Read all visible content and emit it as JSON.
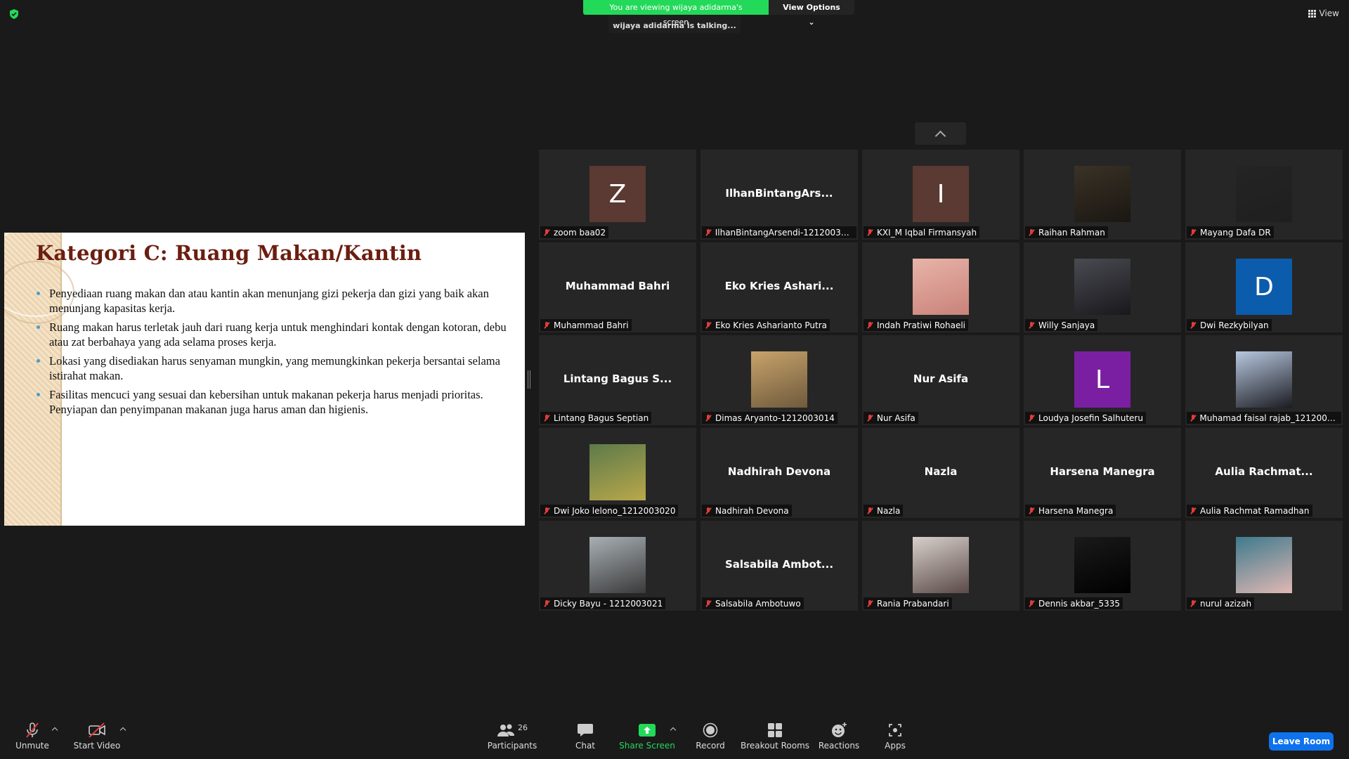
{
  "banner": {
    "viewing": "You are viewing wijaya adidarma's screen",
    "options": "View Options",
    "talking": "wijaya adidarma is talking..."
  },
  "view_label": "View",
  "slide": {
    "title": "Kategori C: Ruang Makan/Kantin",
    "bullets": [
      "Penyediaan ruang makan dan atau kantin akan menunjang gizi pekerja dan  gizi yang baik akan menunjang kapasitas kerja.",
      "Ruang makan harus terletak jauh dari ruang kerja untuk menghindari kontak dengan kotoran, debu atau zat berbahaya yang ada selama proses kerja.",
      "Lokasi yang disediakan harus senyaman mungkin, yang memungkinkan pekerja bersantai selama istirahat makan.",
      "Fasilitas mencuci yang sesuai dan kebersihan untuk makanan pekerja harus menjadi prioritas. Penyiapan dan penyimpanan makanan juga harus aman dan higienis."
    ]
  },
  "participants": [
    {
      "name": "zoom baa02",
      "kind": "letter",
      "letter": "Z",
      "color": "#5a3a32"
    },
    {
      "name": "IlhanBintangArsendi-1212003017",
      "kind": "text",
      "display": "IlhanBintangArs..."
    },
    {
      "name": "KXI_M Iqbal Firmansyah",
      "kind": "letter",
      "letter": "I",
      "color": "#5a3a32"
    },
    {
      "name": "Raihan Rahman",
      "kind": "photo",
      "colors": [
        "#3a3226",
        "#1a1612"
      ]
    },
    {
      "name": "Mayang Dafa DR",
      "kind": "photo",
      "colors": [
        "#242424",
        "#1f1f1f"
      ]
    },
    {
      "name": "Muhammad Bahri",
      "kind": "text",
      "display": "Muhammad Bahri"
    },
    {
      "name": "Eko Kries Asharianto Putra",
      "kind": "text",
      "display": "Eko Kries Ashari..."
    },
    {
      "name": "Indah Pratiwi Rohaeli",
      "kind": "photo",
      "colors": [
        "#e8b4a8",
        "#c9827a"
      ]
    },
    {
      "name": "Willy Sanjaya",
      "kind": "photo",
      "colors": [
        "#4a4a52",
        "#18181c"
      ]
    },
    {
      "name": "Dwi Rezkybilyan",
      "kind": "letter",
      "letter": "D",
      "color": "#0b5cad"
    },
    {
      "name": "Lintang Bagus Septian",
      "kind": "text",
      "display": "Lintang Bagus S..."
    },
    {
      "name": "Dimas Aryanto-1212003014",
      "kind": "photo",
      "colors": [
        "#c8a36b",
        "#6e5a3c"
      ]
    },
    {
      "name": "Nur Asifa",
      "kind": "text",
      "display": "Nur Asifa"
    },
    {
      "name": "Loudya Josefin Salhuteru",
      "kind": "letter",
      "letter": "L",
      "color": "#7b1fa2"
    },
    {
      "name": "Muhamad faisal rajab_12120030...",
      "kind": "photo",
      "colors": [
        "#b7c8e0",
        "#1c1c22"
      ]
    },
    {
      "name": "Dwi Joko lelono_1212003020",
      "kind": "photo",
      "colors": [
        "#5d7a4a",
        "#b9a84a"
      ]
    },
    {
      "name": "Nadhirah Devona",
      "kind": "text",
      "display": "Nadhirah Devona"
    },
    {
      "name": "Nazla",
      "kind": "text",
      "display": "Nazla"
    },
    {
      "name": "Harsena Manegra",
      "kind": "text",
      "display": "Harsena Manegra"
    },
    {
      "name": "Aulia Rachmat Ramadhan",
      "kind": "text",
      "display": "Aulia  Rachmat..."
    },
    {
      "name": "Dicky Bayu - 1212003021",
      "kind": "photo",
      "colors": [
        "#a8b0b4",
        "#3a3a3a"
      ]
    },
    {
      "name": "Salsabila Ambotuwo",
      "kind": "text",
      "display": "Salsabila  Ambot..."
    },
    {
      "name": "Rania Prabandari",
      "kind": "photo",
      "colors": [
        "#d8d0cc",
        "#5a4a48"
      ]
    },
    {
      "name": "Dennis akbar_5335",
      "kind": "photo",
      "colors": [
        "#1a1a1a",
        "#000000"
      ]
    },
    {
      "name": "nurul azizah",
      "kind": "photo",
      "colors": [
        "#3e7a8c",
        "#e0b8b4"
      ]
    }
  ],
  "toolbar": {
    "unmute": "Unmute",
    "start_video": "Start Video",
    "participants": "Participants",
    "participants_count": "26",
    "chat": "Chat",
    "share_screen": "Share Screen",
    "record": "Record",
    "breakout": "Breakout Rooms",
    "reactions": "Reactions",
    "apps": "Apps",
    "leave": "Leave Room"
  },
  "colors": {
    "accent_green": "#23d959",
    "leave_blue": "#0e72ed",
    "slide_title": "#6b1e10"
  }
}
